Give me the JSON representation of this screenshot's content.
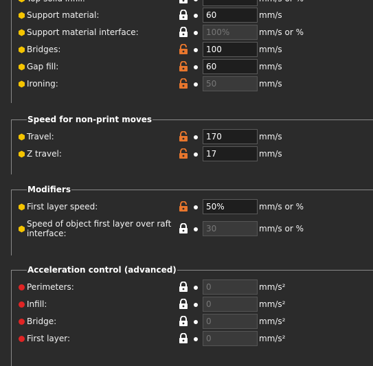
{
  "colors": {
    "yellow": "#f5c400",
    "red": "#e02424",
    "orange": "#e8762d",
    "white": "#ffffff"
  },
  "speed_for_print_moves": {
    "rows": [
      {
        "label": "Top solid infill:",
        "value": "",
        "unit": "mm/s or %",
        "lock": "locked",
        "indicator": "yellow"
      },
      {
        "label": "Support material:",
        "value": "60",
        "unit": "mm/s",
        "lock": "locked",
        "indicator": "yellow"
      },
      {
        "label": "Support material interface:",
        "value": "100%",
        "unit": "mm/s or %",
        "lock": "locked",
        "indicator": "yellow",
        "disabled": true
      },
      {
        "label": "Bridges:",
        "value": "100",
        "unit": "mm/s",
        "lock": "unlocked",
        "indicator": "yellow"
      },
      {
        "label": "Gap fill:",
        "value": "60",
        "unit": "mm/s",
        "lock": "unlocked",
        "indicator": "yellow"
      },
      {
        "label": "Ironing:",
        "value": "50",
        "unit": "mm/s",
        "lock": "unlocked",
        "indicator": "yellow",
        "disabled": true
      }
    ]
  },
  "non_print": {
    "title": "Speed for non-print moves",
    "rows": [
      {
        "label": "Travel:",
        "value": "170",
        "unit": "mm/s",
        "lock": "unlocked",
        "indicator": "yellow"
      },
      {
        "label": "Z travel:",
        "value": "17",
        "unit": "mm/s",
        "lock": "unlocked",
        "indicator": "yellow"
      }
    ]
  },
  "modifiers": {
    "title": "Modifiers",
    "rows": [
      {
        "label": "First layer speed:",
        "value": "50%",
        "unit": "mm/s or %",
        "lock": "unlocked",
        "indicator": "yellow"
      },
      {
        "label": "Speed of object first layer over raft interface:",
        "value": "30",
        "unit": "mm/s or %",
        "lock": "locked",
        "indicator": "yellow",
        "disabled": true
      }
    ]
  },
  "acceleration": {
    "title": "Acceleration control (advanced)",
    "rows": [
      {
        "label": "Perimeters:",
        "value": "0",
        "unit": "mm/s²",
        "lock": "locked",
        "indicator": "red",
        "disabled": true
      },
      {
        "label": "Infill:",
        "value": "0",
        "unit": "mm/s²",
        "lock": "locked",
        "indicator": "red",
        "disabled": true
      },
      {
        "label": "Bridge:",
        "value": "0",
        "unit": "mm/s²",
        "lock": "locked",
        "indicator": "red",
        "disabled": true
      },
      {
        "label": "First layer:",
        "value": "0",
        "unit": "mm/s²",
        "lock": "locked",
        "indicator": "red",
        "disabled": true
      }
    ]
  }
}
